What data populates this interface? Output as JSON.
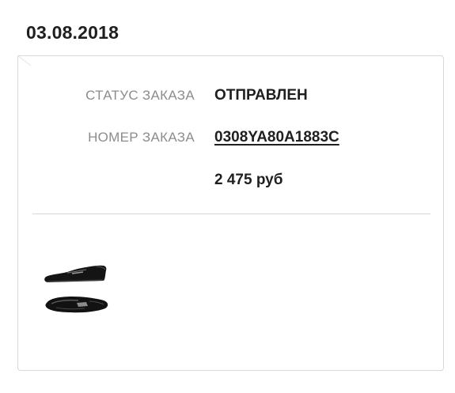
{
  "order": {
    "date": "03.08.2018",
    "status_label": "СТАТУС ЗАКАЗА",
    "status_value": "ОТПРАВЛЕН",
    "number_label": "НОМЕР ЗАКАЗА",
    "number_value": "0308YA80A1883C",
    "price": "2 475 руб"
  },
  "products": [
    {
      "icon": "loafer-shoe-icon"
    }
  ],
  "colors": {
    "label": "#8c8c8c",
    "value": "#1f1f1f",
    "border": "#d9d9d9"
  }
}
